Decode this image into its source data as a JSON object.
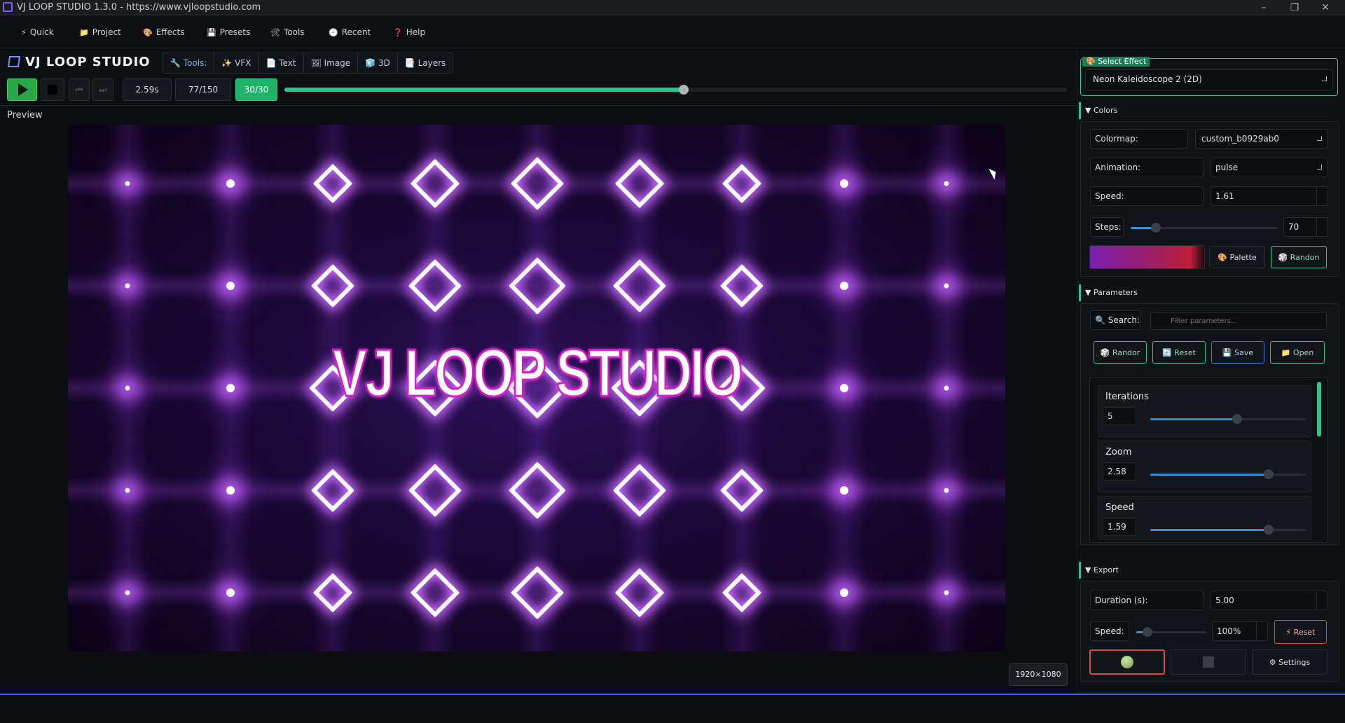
{
  "window": {
    "title": "VJ LOOP STUDIO 1.3.0 - https://www.vjloopstudio.com",
    "minimize": "–",
    "restore": "❐",
    "close": "✕"
  },
  "menu": [
    {
      "icon": "⚡",
      "label": "Quick"
    },
    {
      "icon": "📁",
      "label": "Project"
    },
    {
      "icon": "🎨",
      "label": "Effects"
    },
    {
      "icon": "💾",
      "label": "Presets"
    },
    {
      "icon": "🛠",
      "label": "Tools"
    },
    {
      "icon": "🕘",
      "label": "Recent"
    },
    {
      "icon": "❓",
      "label": "Help"
    }
  ],
  "brand": {
    "name": "VJ LOOP STUDIO"
  },
  "toolbar": {
    "tools_label": "Tools:",
    "items": [
      "VFX",
      "Text",
      "Image",
      "3D",
      "Layers"
    ]
  },
  "transport": {
    "time": "2.59s",
    "frame": "77/150",
    "fps": "30/30",
    "progress": 0.51
  },
  "preview": {
    "label": "Preview",
    "overlay_text": "VJ LOOP STUDIO",
    "resolution": "1920×1080"
  },
  "select_effect": {
    "title": "Select Effect",
    "value": "Neon Kaleidoscope 2 (2D)"
  },
  "colors": {
    "header": "Colors",
    "colormap_label": "Colormap:",
    "colormap_value": "custom_b0929ab0",
    "animation_label": "Animation:",
    "animation_value": "pulse",
    "speed_label": "Speed:",
    "speed_value": "1.61",
    "steps_label": "Steps:",
    "steps_value": "70",
    "steps_fraction": 0.17,
    "palette_button": "Palette",
    "random_button": "Randon",
    "gradient_start": "#7a1fb0",
    "gradient_end": "#c01e3a"
  },
  "parameters": {
    "header": "Parameters",
    "search_label": "Search:",
    "search_placeholder": "Filter parameters...",
    "buttons": [
      "Randor",
      "Reset",
      "Save",
      "Open"
    ],
    "items": [
      {
        "name": "Iterations",
        "value": "5",
        "fraction": 0.56
      },
      {
        "name": "Zoom",
        "value": "2.58",
        "fraction": 0.76
      },
      {
        "name": "Speed",
        "value": "1.59",
        "fraction": 0.76
      }
    ]
  },
  "export": {
    "header": "Export",
    "duration_label": "Duration (s):",
    "duration_value": "5.00",
    "speed_label": "Speed:",
    "speed_value": "100%",
    "speed_fraction": 0.16,
    "reset_button": "Reset",
    "settings_button": "Settings"
  },
  "colors_theme": {
    "accent_green": "#2ec48d",
    "accent_blue": "#2d6bd8",
    "record_red": "#d94848"
  }
}
